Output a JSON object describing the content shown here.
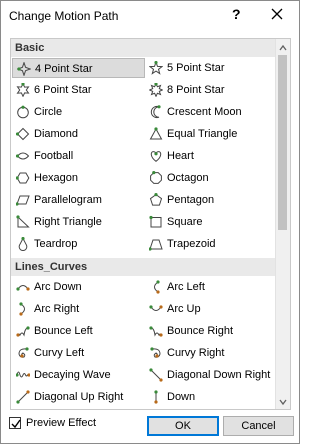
{
  "window": {
    "title": "Change Motion Path",
    "help_label": "?"
  },
  "groups": [
    {
      "label": "Basic",
      "items": [
        {
          "label": "4 Point Star",
          "icon": "star4-icon",
          "selected": true
        },
        {
          "label": "5 Point Star",
          "icon": "star5-icon"
        },
        {
          "label": "6 Point Star",
          "icon": "star6-icon"
        },
        {
          "label": "8 Point Star",
          "icon": "star8-icon"
        },
        {
          "label": "Circle",
          "icon": "circle-icon"
        },
        {
          "label": "Crescent Moon",
          "icon": "crescent-moon-icon"
        },
        {
          "label": "Diamond",
          "icon": "diamond-icon"
        },
        {
          "label": "Equal Triangle",
          "icon": "equal-triangle-icon"
        },
        {
          "label": "Football",
          "icon": "football-icon"
        },
        {
          "label": "Heart",
          "icon": "heart-icon"
        },
        {
          "label": "Hexagon",
          "icon": "hexagon-icon"
        },
        {
          "label": "Octagon",
          "icon": "octagon-icon"
        },
        {
          "label": "Parallelogram",
          "icon": "parallelogram-icon"
        },
        {
          "label": "Pentagon",
          "icon": "pentagon-icon"
        },
        {
          "label": "Right Triangle",
          "icon": "right-triangle-icon"
        },
        {
          "label": "Square",
          "icon": "square-icon"
        },
        {
          "label": "Teardrop",
          "icon": "teardrop-icon"
        },
        {
          "label": "Trapezoid",
          "icon": "trapezoid-icon"
        }
      ]
    },
    {
      "label": "Lines_Curves",
      "items": [
        {
          "label": "Arc Down",
          "icon": "arc-down-icon"
        },
        {
          "label": "Arc Left",
          "icon": "arc-left-icon"
        },
        {
          "label": "Arc Right",
          "icon": "arc-right-icon"
        },
        {
          "label": "Arc Up",
          "icon": "arc-up-icon"
        },
        {
          "label": "Bounce Left",
          "icon": "bounce-left-icon"
        },
        {
          "label": "Bounce Right",
          "icon": "bounce-right-icon"
        },
        {
          "label": "Curvy Left",
          "icon": "curvy-left-icon"
        },
        {
          "label": "Curvy Right",
          "icon": "curvy-right-icon"
        },
        {
          "label": "Decaying Wave",
          "icon": "decaying-wave-icon"
        },
        {
          "label": "Diagonal Down Right",
          "icon": "diagonal-down-right-icon"
        },
        {
          "label": "Diagonal Up Right",
          "icon": "diagonal-up-right-icon"
        },
        {
          "label": "Down",
          "icon": "down-icon"
        }
      ]
    }
  ],
  "preview": {
    "label": "Preview Effect",
    "checked": true
  },
  "buttons": {
    "ok": "OK",
    "cancel": "Cancel"
  },
  "colors": {
    "icon_green": "#3a8a3a",
    "icon_orange": "#b86a1a",
    "selection": "#dcdcdc",
    "ok_border": "#0078d7"
  }
}
